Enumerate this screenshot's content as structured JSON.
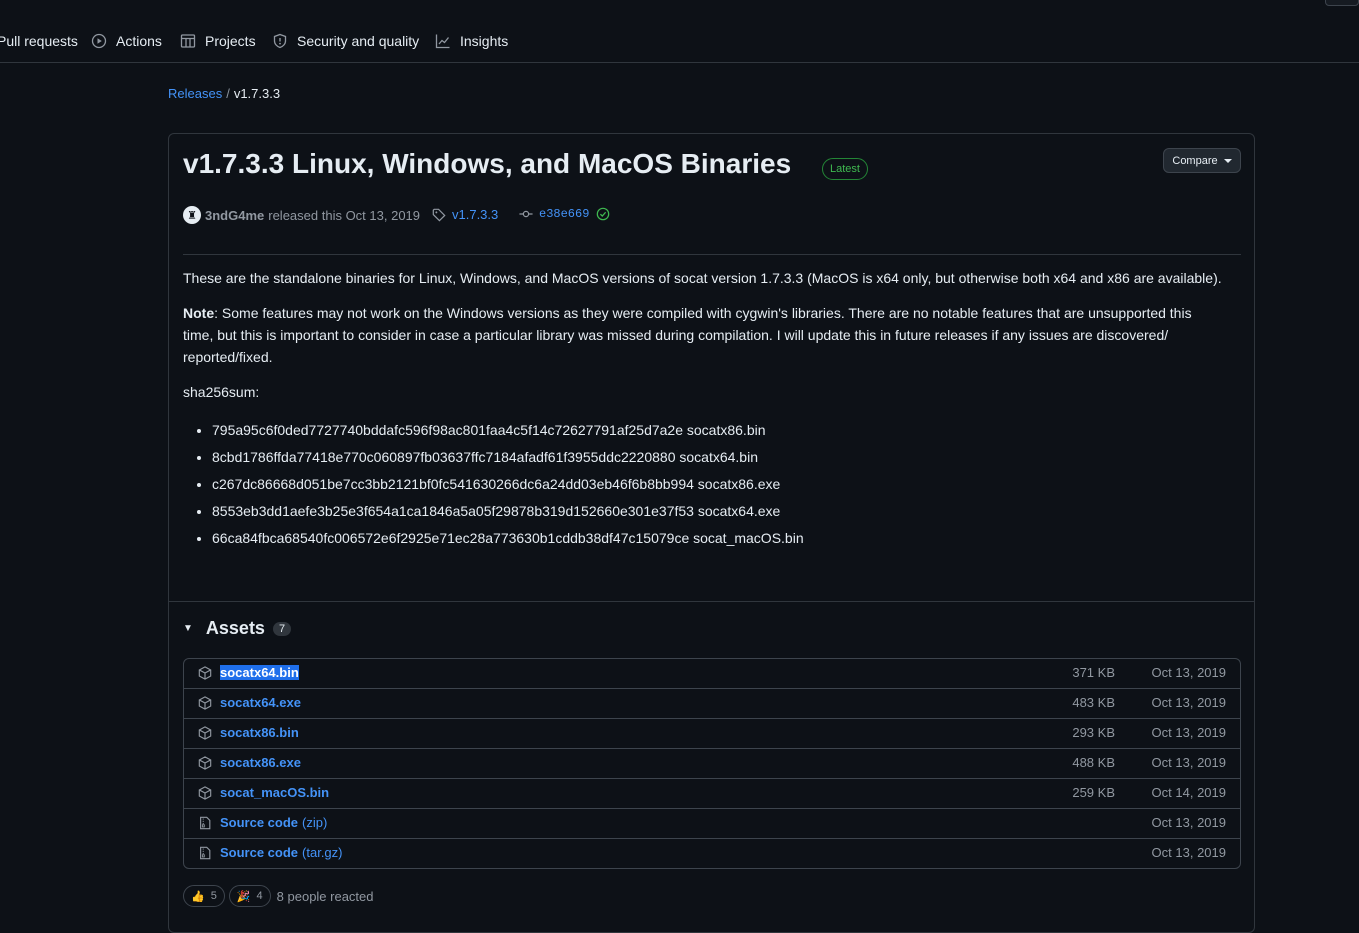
{
  "nav": {
    "items": [
      {
        "label": "Pull requests",
        "icon": "pull-request-icon"
      },
      {
        "label": "Actions",
        "icon": "play-icon"
      },
      {
        "label": "Projects",
        "icon": "table-icon"
      },
      {
        "label": "Security and quality",
        "icon": "shield-icon"
      },
      {
        "label": "Insights",
        "icon": "graph-icon"
      }
    ]
  },
  "breadcrumb": {
    "releases": "Releases",
    "separator": "/",
    "current": "v1.7.3.3"
  },
  "release": {
    "title": "v1.7.3.3 Linux, Windows, and MacOS Binaries",
    "badge": "Latest",
    "compare_label": "Compare",
    "author": "3ndG4me",
    "released_text": "released this Oct 13, 2019",
    "tag": "v1.7.3.3",
    "commit": "e38e669",
    "paragraph1": "These are the standalone binaries for Linux, Windows, and MacOS versions of socat version 1.7.3.3 (MacOS is x64 only, but otherwise both x64 and x86 are available).",
    "note_label": "Note",
    "note_text": ": Some features may not work on the Windows versions as they were compiled with cygwin's libraries. There are no notable features that are unsupported this time, but this is important to consider in case a particular library was missed during compilation. I will update this in future releases if any issues are discovered/ reported/fixed.",
    "sha_label": "sha256sum:",
    "hashes": [
      "795a95c6f0ded7727740bddafc596f98ac801faa4c5f14c72627791af25d7a2e socatx86.bin",
      "8cbd1786ffda77418e770c060897fb03637ffc7184afadf61f3955ddc2220880 socatx64.bin",
      "c267dc86668d051be7cc3bb2121bf0fc541630266dc6a24dd03eb46f6b8bb994 socatx86.exe",
      "8553eb3dd1aefe3b25e3f654a1ca1846a5a05f29878b319d152660e301e37f53 socatx64.exe",
      "66ca84fbca68540fc006572e6f2925e71ec28a773630b1cddb38df47c15079ce socat_macOS.bin"
    ]
  },
  "assets": {
    "heading": "Assets",
    "count": "7",
    "items": [
      {
        "name": "socatx64.bin",
        "sub": "",
        "size": "371 KB",
        "date": "Oct 13, 2019",
        "icon": "package-icon"
      },
      {
        "name": "socatx64.exe",
        "sub": "",
        "size": "483 KB",
        "date": "Oct 13, 2019",
        "icon": "package-icon"
      },
      {
        "name": "socatx86.bin",
        "sub": "",
        "size": "293 KB",
        "date": "Oct 13, 2019",
        "icon": "package-icon"
      },
      {
        "name": "socatx86.exe",
        "sub": "",
        "size": "488 KB",
        "date": "Oct 13, 2019",
        "icon": "package-icon"
      },
      {
        "name": "socat_macOS.bin",
        "sub": "",
        "size": "259 KB",
        "date": "Oct 14, 2019",
        "icon": "package-icon"
      },
      {
        "name": "Source code",
        "sub": "(zip)",
        "size": "",
        "date": "Oct 13, 2019",
        "icon": "file-zip-icon"
      },
      {
        "name": "Source code",
        "sub": "(tar.gz)",
        "size": "",
        "date": "Oct 13, 2019",
        "icon": "file-zip-icon"
      }
    ]
  },
  "reactions": {
    "thumbs_up": {
      "emoji": "👍",
      "count": "5"
    },
    "tada": {
      "emoji": "🎉",
      "count": "4"
    },
    "summary": "8 people reacted"
  }
}
